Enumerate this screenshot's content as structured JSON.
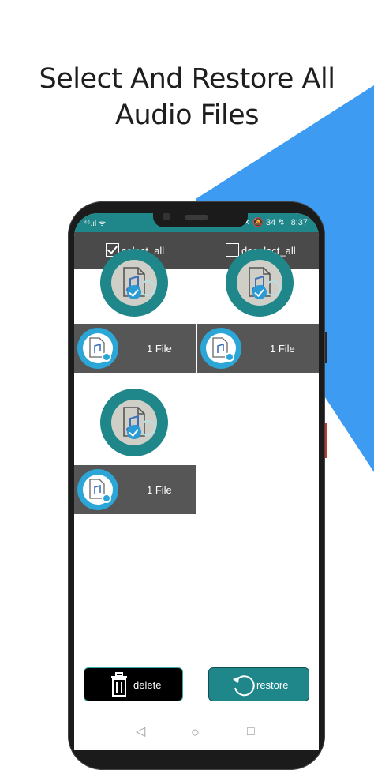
{
  "headline": {
    "line1": "Select And Restore All",
    "line2": "Audio Files"
  },
  "colors": {
    "accent_blue": "#3d9bf2",
    "teal": "#1f868a",
    "toolbar": "#4a4a4a",
    "bar": "#565656"
  },
  "status_bar": {
    "left": "⁴⁶.ıl ᯤ",
    "right_icons": "⊙ ✕ 🔕 34 ↯",
    "time": "8:37"
  },
  "toolbar": {
    "select_all": {
      "label": "select_all",
      "checked": true
    },
    "deselect_all": {
      "label": "deselect_all",
      "checked": false
    }
  },
  "files": [
    {
      "label": "1 File",
      "icon": "audio-file-icon"
    },
    {
      "label": "1 File",
      "icon": "audio-file-icon"
    },
    {
      "label": "1 File",
      "icon": "audio-file-icon"
    }
  ],
  "actions": {
    "delete_label": "delete",
    "restore_label": "restore"
  },
  "nav": {
    "back": "◁",
    "home": "○",
    "recents": "□"
  }
}
